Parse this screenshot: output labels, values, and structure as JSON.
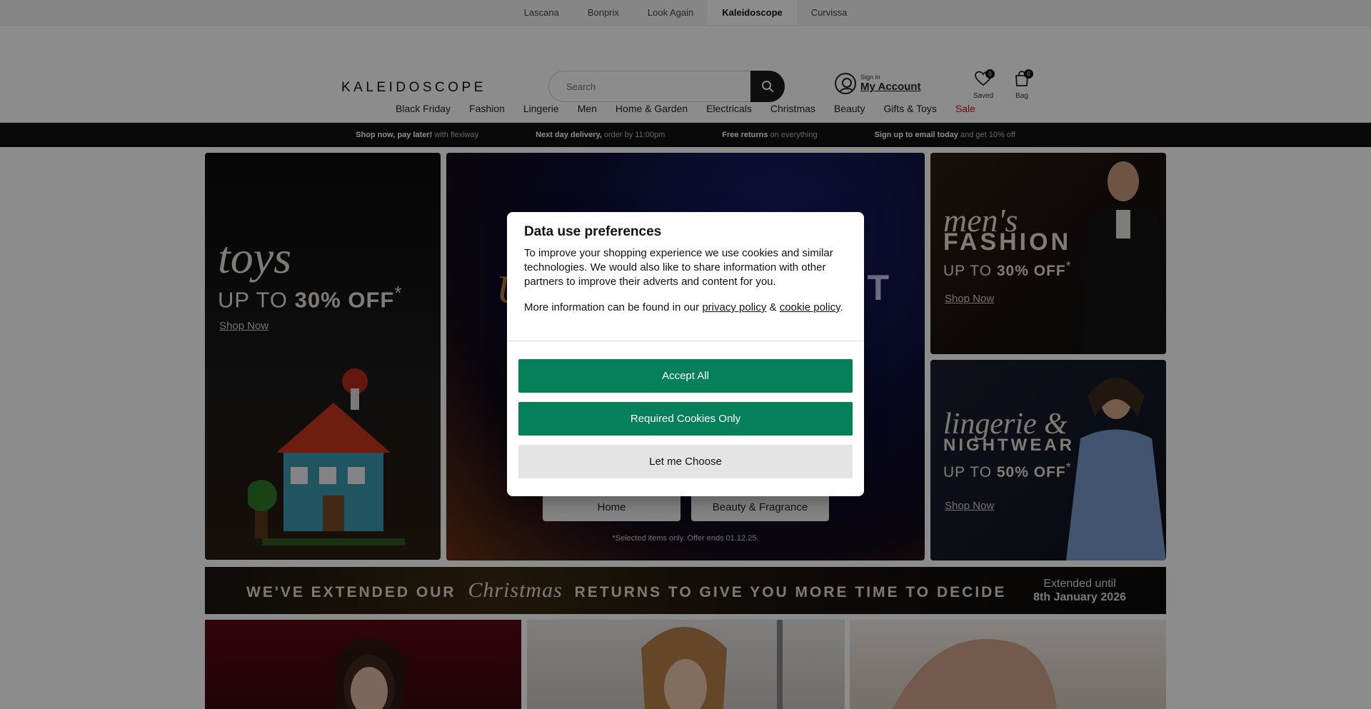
{
  "brand_strip": {
    "items": [
      {
        "label": "Lascana",
        "active": false
      },
      {
        "label": "Bonprix",
        "active": false
      },
      {
        "label": "Look Again",
        "active": false
      },
      {
        "label": "Kaleidoscope",
        "active": true
      },
      {
        "label": "Curvissa",
        "active": false
      }
    ]
  },
  "header": {
    "logo_text": "KALEIDOSCOPE",
    "search_placeholder": "Search",
    "account_small": "Sign in",
    "account_label": "My Account",
    "saved_label": "Saved",
    "saved_count": "0",
    "bag_label": "Bag",
    "bag_count": "0"
  },
  "nav": {
    "items": [
      "Black Friday",
      "Fashion",
      "Lingerie",
      "Men",
      "Home & Garden",
      "Electricals",
      "Christmas",
      "Beauty",
      "Gifts & Toys",
      "Sale"
    ]
  },
  "promo_bar": [
    {
      "bold": "Shop now, pay later!",
      "text": "with flexiway"
    },
    {
      "bold": "Next day delivery,",
      "text": "order by 11:00pm"
    },
    {
      "bold": "Free returns",
      "text": "on everything"
    },
    {
      "bold": "Sign up to email today",
      "text": "and get 10% off"
    }
  ],
  "hero": {
    "toys": {
      "script": "toys",
      "upto_prefix": "UP TO ",
      "upto_value": "30% OFF",
      "asterisk": "*",
      "shop": "Shop Now"
    },
    "mens": {
      "script": "men's",
      "title": "FASHION",
      "upto_prefix": "UP TO ",
      "upto_value": "30% OFF",
      "asterisk": "*",
      "shop": "Shop Now"
    },
    "lingerie": {
      "script": "lingerie &",
      "title": "NIGHTWEAR",
      "upto_prefix": "UP TO ",
      "upto_value": "50% OFF",
      "asterisk": "*",
      "shop": "Shop Now"
    },
    "center": {
      "partial_left": "U",
      "partial_right": "T",
      "categories": [
        "Home",
        "Beauty & Fragrance"
      ],
      "note": "*Selected items only. Offer ends 01.12.25."
    }
  },
  "xmas_banner": {
    "prefix": "WE'VE EXTENDED OUR",
    "cursive": "Christmas",
    "suffix": "RETURNS TO GIVE YOU MORE TIME TO DECIDE",
    "extended_line1": "Extended until",
    "extended_line2": "8th January 2026"
  },
  "modal": {
    "title": "Data use preferences",
    "paragraph1": "To improve your shopping experience we use cookies and similar technologies. We would also like to share information with other partners to improve their adverts and content for you.",
    "paragraph2_prefix": "More information can be found in our",
    "privacy_link": "privacy policy",
    "amp": "&",
    "cookie_link": "cookie policy",
    "period": ".",
    "accept_all": "Accept All",
    "required_only": "Required Cookies Only",
    "let_me_choose": "Let me Choose"
  },
  "colors": {
    "accent_green": "#06805a",
    "sale_red": "#c8102e",
    "promo_bg": "#111111"
  }
}
